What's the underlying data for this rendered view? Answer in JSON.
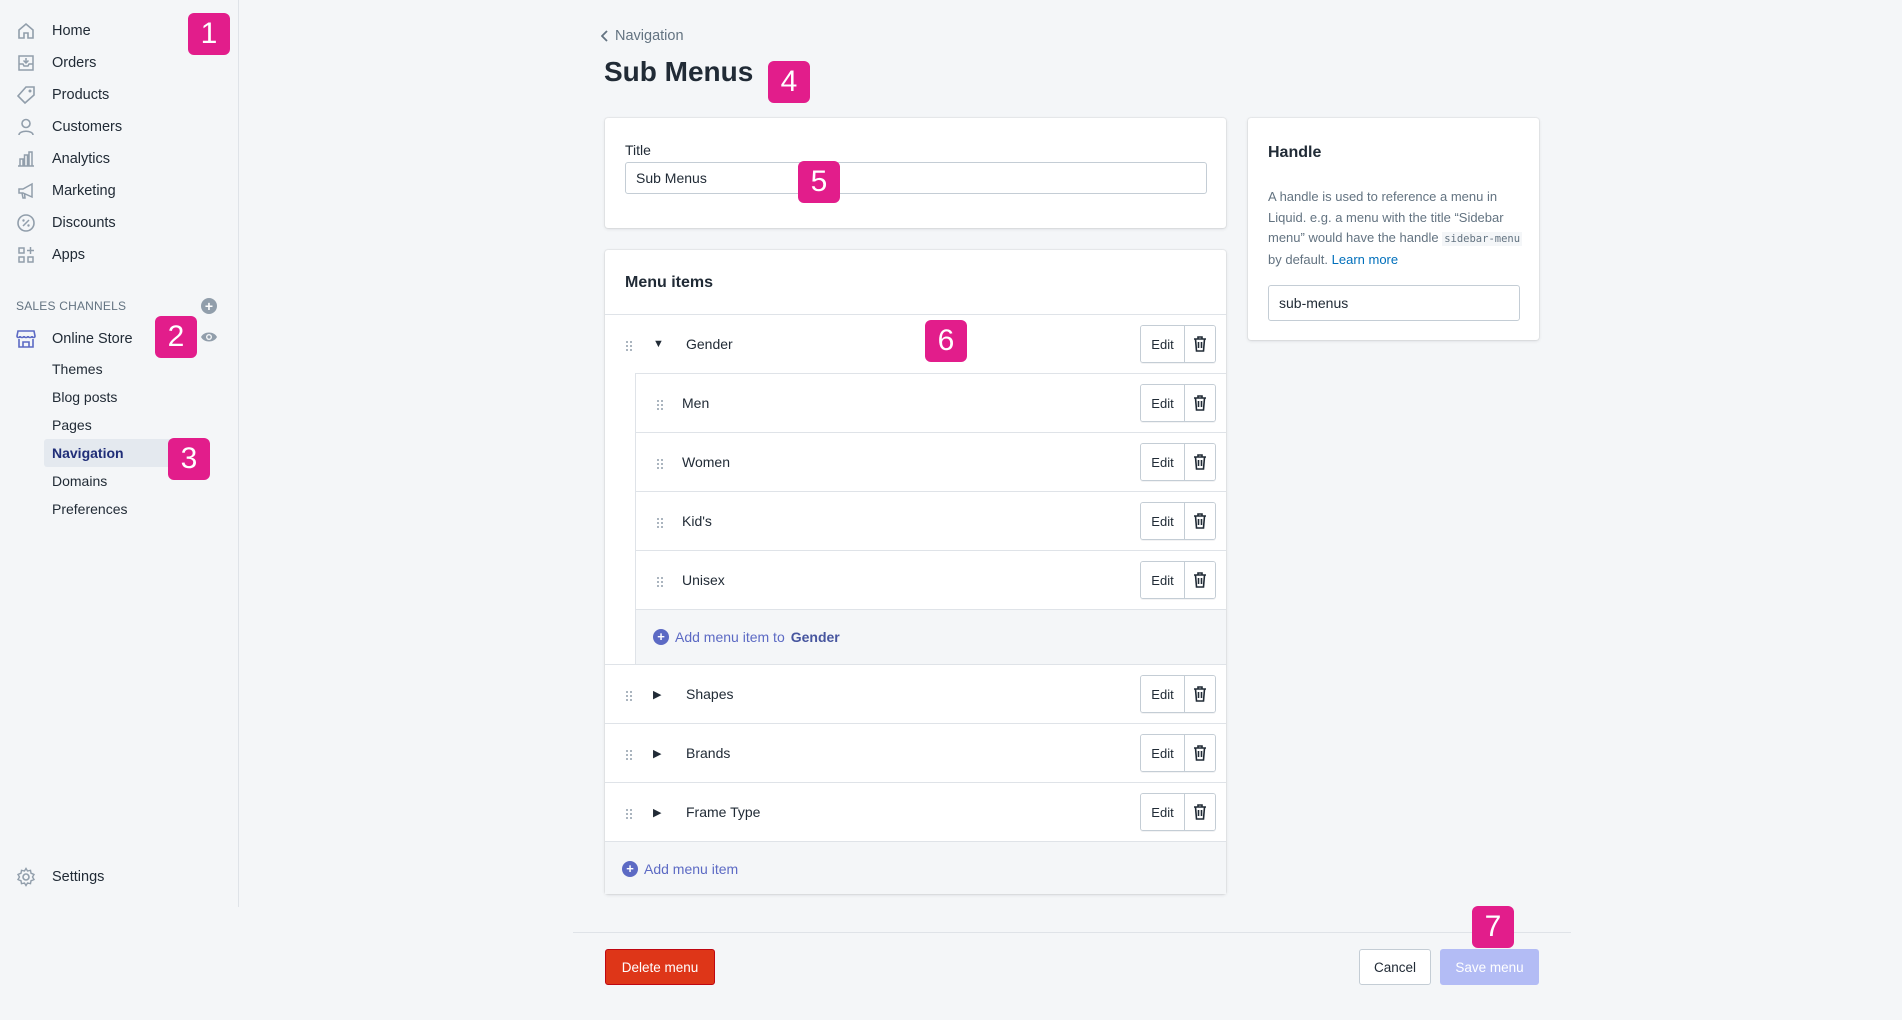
{
  "sidebar": {
    "items": [
      {
        "label": "Home",
        "icon": "home-icon"
      },
      {
        "label": "Orders",
        "icon": "orders-icon"
      },
      {
        "label": "Products",
        "icon": "tag-icon"
      },
      {
        "label": "Customers",
        "icon": "person-icon"
      },
      {
        "label": "Analytics",
        "icon": "bar-chart-icon"
      },
      {
        "label": "Marketing",
        "icon": "megaphone-icon"
      },
      {
        "label": "Discounts",
        "icon": "discount-icon"
      },
      {
        "label": "Apps",
        "icon": "apps-icon"
      }
    ],
    "sales_channels_heading": "SALES CHANNELS",
    "online_store": {
      "label": "Online Store",
      "icon": "store-icon"
    },
    "sub_items": [
      "Themes",
      "Blog posts",
      "Pages",
      "Navigation",
      "Domains",
      "Preferences"
    ],
    "active_sub_item": "Navigation",
    "settings": {
      "label": "Settings",
      "icon": "gear-icon"
    }
  },
  "badges": [
    "1",
    "2",
    "3",
    "4",
    "5",
    "6",
    "7"
  ],
  "breadcrumb": {
    "back_label": "Navigation"
  },
  "page_title": "Sub Menus",
  "title_card": {
    "label": "Title",
    "value": "Sub Menus"
  },
  "menu_card": {
    "heading": "Menu items",
    "items": [
      {
        "label": "Gender",
        "expanded": true,
        "edit": "Edit",
        "children": [
          {
            "label": "Men",
            "edit": "Edit"
          },
          {
            "label": "Women",
            "edit": "Edit"
          },
          {
            "label": "Kid's",
            "edit": "Edit"
          },
          {
            "label": "Unisex",
            "edit": "Edit"
          }
        ],
        "add_child_prefix": "Add menu item to",
        "add_child_target": "Gender"
      },
      {
        "label": "Shapes",
        "expanded": false,
        "edit": "Edit"
      },
      {
        "label": "Brands",
        "expanded": false,
        "edit": "Edit"
      },
      {
        "label": "Frame Type",
        "expanded": false,
        "edit": "Edit"
      }
    ],
    "add_menu_item": "Add menu item"
  },
  "handle_card": {
    "heading": "Handle",
    "desc_1": "A handle is used to reference a menu in Liquid. e.g. a menu with the title “Sidebar menu” would have the handle",
    "desc_code": "sidebar-menu",
    "desc_2": "by default.",
    "learn_more": "Learn more",
    "value": "sub-menus"
  },
  "footer": {
    "delete_label": "Delete menu",
    "cancel_label": "Cancel",
    "save_label": "Save menu"
  },
  "colors": {
    "accent": "#5c6ac4",
    "danger": "#de3618",
    "badge": "#e21d8b",
    "save_disabled": "#b3bcf5"
  }
}
